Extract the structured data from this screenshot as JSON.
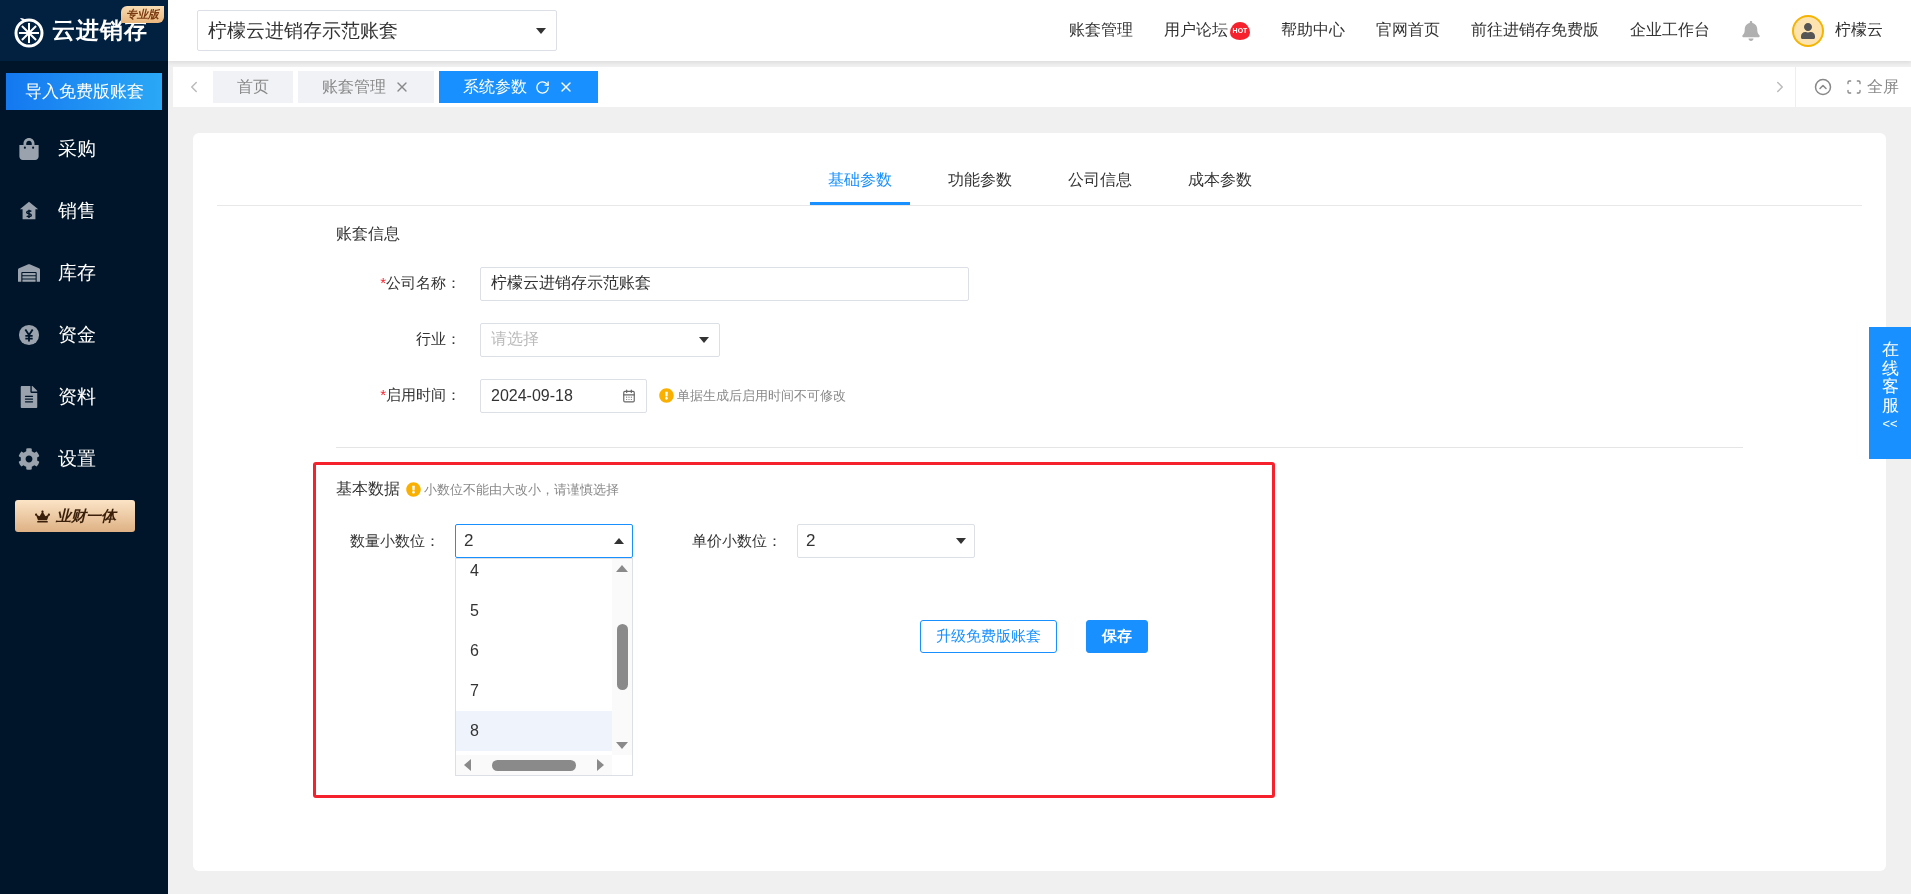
{
  "sidebar": {
    "logo_text": "云进销存",
    "edition_badge": "专业版",
    "import_button": "导入免费版账套",
    "items": [
      {
        "label": "采购"
      },
      {
        "label": "销售"
      },
      {
        "label": "库存"
      },
      {
        "label": "资金"
      },
      {
        "label": "资料"
      },
      {
        "label": "设置"
      }
    ],
    "promo_button": "业财一体"
  },
  "topbar": {
    "account_select": "柠檬云进销存示范账套",
    "links": [
      {
        "label": "账套管理"
      },
      {
        "label": "用户论坛",
        "badge": "HOT"
      },
      {
        "label": "帮助中心"
      },
      {
        "label": "官网首页"
      },
      {
        "label": "前往进销存免费版"
      },
      {
        "label": "企业工作台"
      }
    ],
    "user_name": "柠檬云"
  },
  "page_tabs": {
    "items": [
      {
        "label": "首页",
        "selected": false,
        "closable": false,
        "refreshable": false
      },
      {
        "label": "账套管理",
        "selected": false,
        "closable": true,
        "refreshable": false
      },
      {
        "label": "系统参数",
        "selected": true,
        "closable": true,
        "refreshable": true
      }
    ],
    "fullscreen": "全屏"
  },
  "settings_tabs": [
    {
      "label": "基础参数",
      "selected": true
    },
    {
      "label": "功能参数",
      "selected": false
    },
    {
      "label": "公司信息",
      "selected": false
    },
    {
      "label": "成本参数",
      "selected": false
    }
  ],
  "account_info": {
    "title": "账套信息",
    "fields": [
      {
        "label": "公司名称：",
        "required_mark": "*",
        "kind": "text",
        "value": "柠檬云进销存示范账套"
      },
      {
        "label": "行业：",
        "kind": "select",
        "placeholder": "请选择"
      },
      {
        "label": "启用时间：",
        "required_mark": "*",
        "kind": "date",
        "value": "2024-09-18",
        "hint": "单据生成后启用时间不可修改"
      }
    ]
  },
  "basic_data": {
    "title": "基本数据",
    "hint": "小数位不能由大改小，请谨慎选择",
    "fields": [
      {
        "label": "数量小数位：",
        "value": "2",
        "expanded": true,
        "options": [
          {
            "label": "4",
            "highlighted": false
          },
          {
            "label": "5",
            "highlighted": false
          },
          {
            "label": "6",
            "highlighted": false
          },
          {
            "label": "7",
            "highlighted": false
          },
          {
            "label": "8",
            "highlighted": true
          }
        ]
      },
      {
        "label": "单价小数位：",
        "value": "2",
        "expanded": false
      }
    ]
  },
  "buttons": [
    {
      "label": "升级免费版账套",
      "kind": "outline"
    },
    {
      "label": "保存",
      "kind": "primary"
    }
  ],
  "online_service": {
    "label": "在线客服",
    "arrow": "<<"
  }
}
